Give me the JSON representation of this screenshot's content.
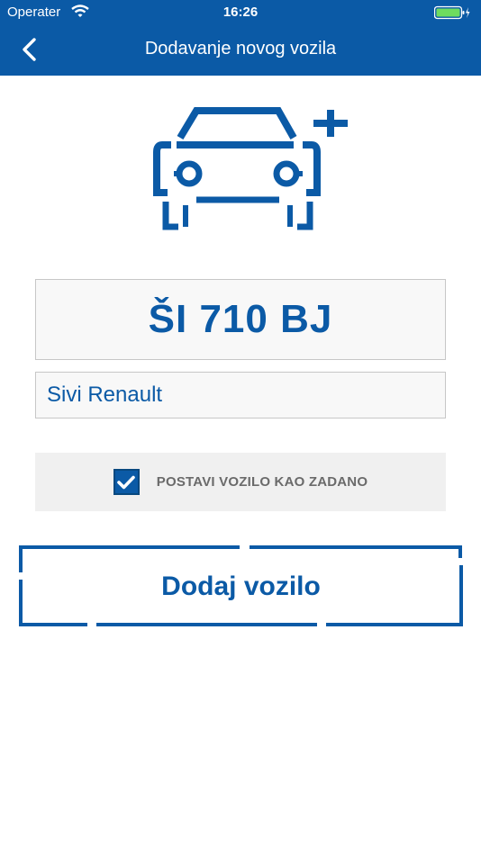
{
  "status": {
    "carrier": "Operater",
    "time": "16:26"
  },
  "nav": {
    "title": "Dodavanje novog vozila"
  },
  "vehicle": {
    "plate": "ŠI 710 BJ",
    "name": "Sivi Renault",
    "default_checked": true,
    "default_label": "POSTAVI VOZILO KAO ZADANO"
  },
  "actions": {
    "add_label": "Dodaj vozilo"
  },
  "icons": {
    "back": "chevron-left-icon",
    "wifi": "wifi-icon",
    "battery": "battery-icon",
    "illustration": "car-plus-icon",
    "check": "checkmark-icon"
  },
  "colors": {
    "brand": "#0b5aa6",
    "checkbox_label": "#6a6a6a"
  }
}
